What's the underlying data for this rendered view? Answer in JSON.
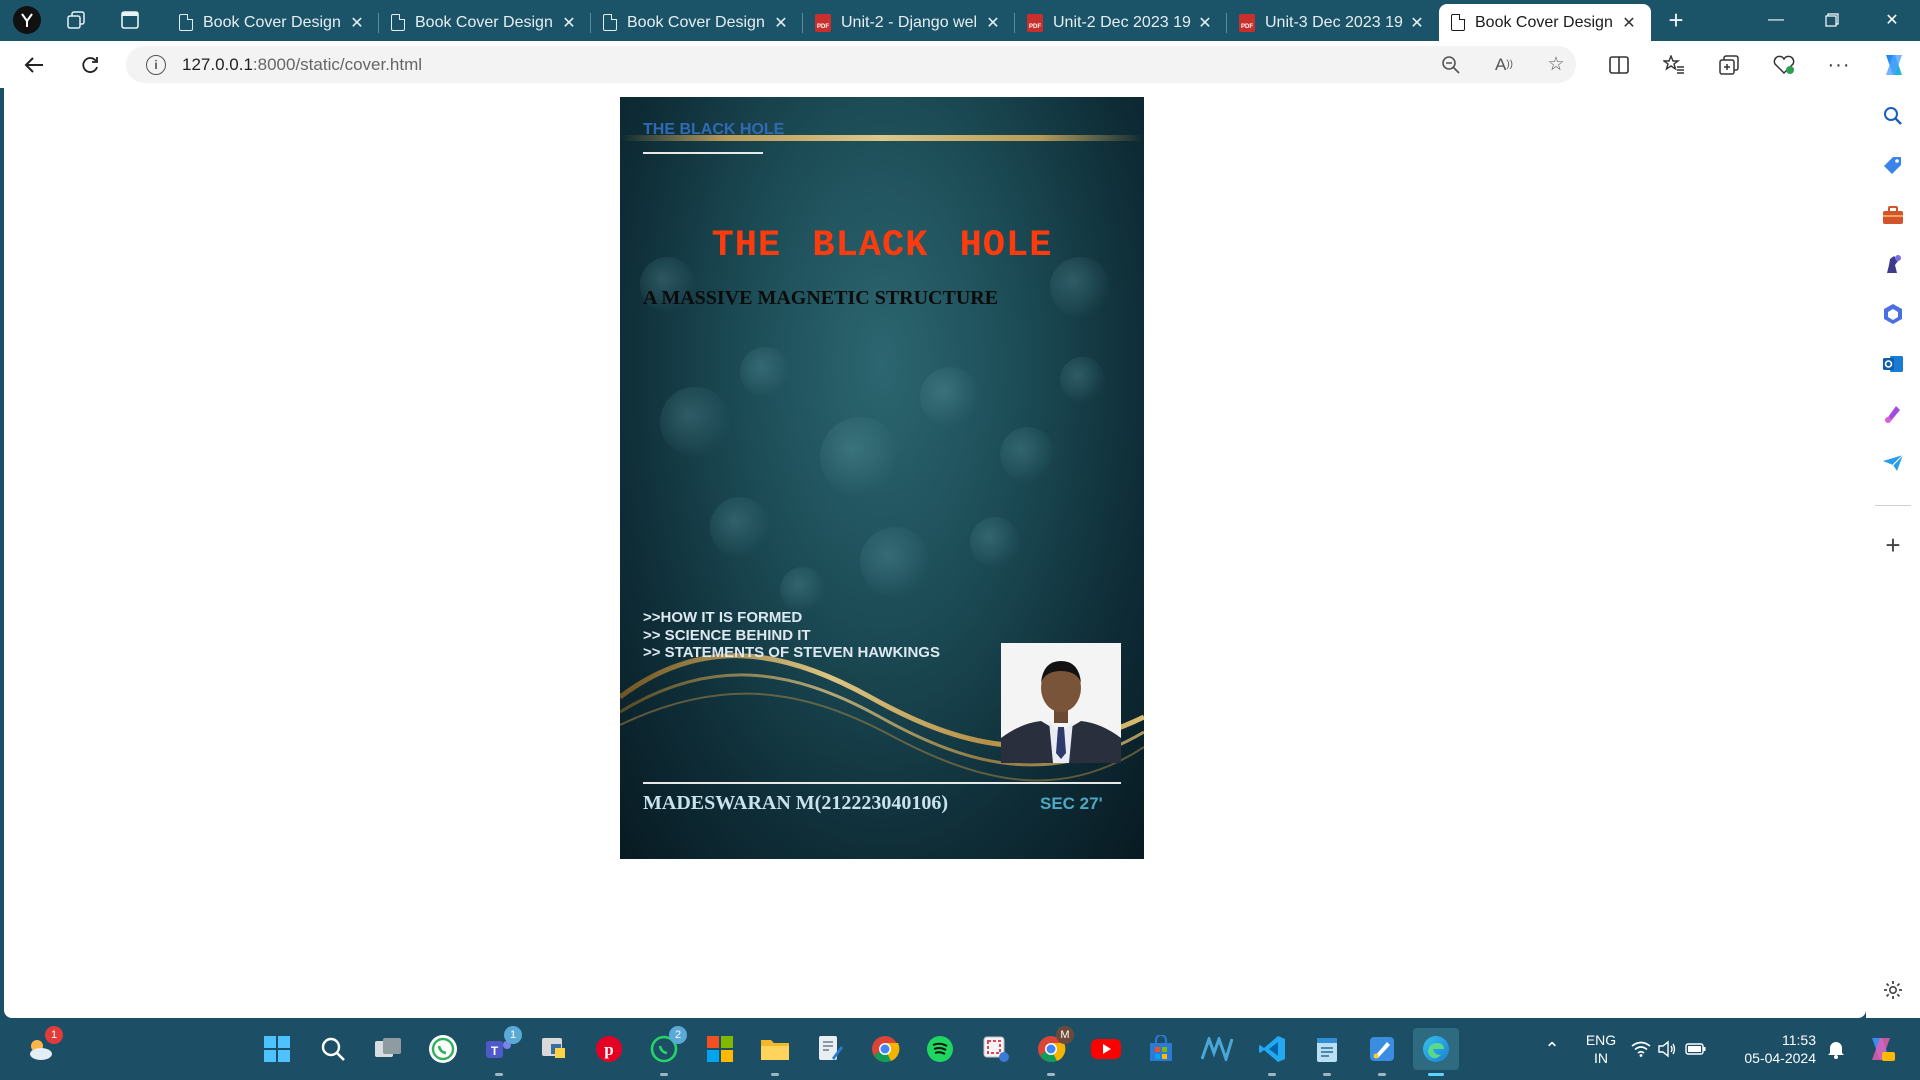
{
  "browser": {
    "tabs": [
      {
        "title": "Book Cover Design",
        "kind": "page"
      },
      {
        "title": "Book Cover Design",
        "kind": "page"
      },
      {
        "title": "Book Cover Design",
        "kind": "page"
      },
      {
        "title": "Unit-2 - Django wel",
        "kind": "pdf"
      },
      {
        "title": "Unit-2 Dec 2023 19",
        "kind": "pdf"
      },
      {
        "title": "Unit-3 Dec 2023 19",
        "kind": "pdf"
      },
      {
        "title": "Book Cover Design",
        "kind": "page",
        "active": true
      }
    ],
    "url_host": "127.0.0.1",
    "url_path": ":8000/static/cover.html"
  },
  "cover": {
    "top_label": "THE BLACK HOLE",
    "title": "THE  BLACK  HOLE",
    "subtitle": "A MASSIVE MAGNETIC STRUCTURE",
    "points": [
      ">>HOW IT IS FORMED",
      ">> SCIENCE BEHIND IT",
      ">> STATEMENTS OF STEVEN HAWKINGS"
    ],
    "author": "MADESWARAN M(212223040106)",
    "section": "SEC 27'"
  },
  "taskbar": {
    "weather_badge": "1",
    "teams_badge": "1",
    "whatsapp_badge": "2",
    "chrome_profile_badge": "M",
    "language": "ENG",
    "region": "IN",
    "time": "11:53",
    "date": "05-04-2024"
  },
  "colors": {
    "tabstrip": "#1b5468",
    "taskbar": "#1c4f66",
    "cover_title": "#ff3b0e",
    "cover_top_label": "#2f6bb4"
  }
}
